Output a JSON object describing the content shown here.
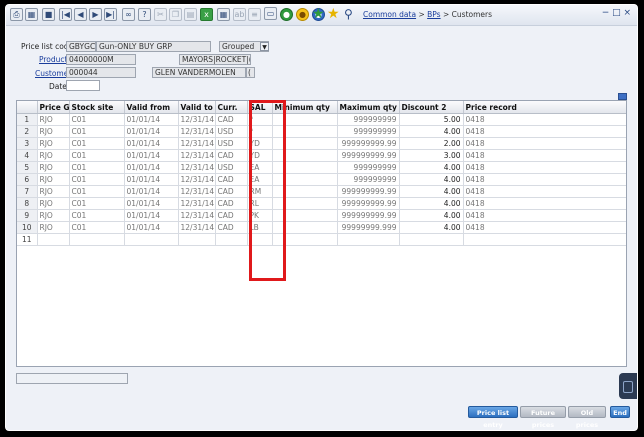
{
  "toolbar": {
    "icons": [
      "printer-icon",
      "table-icon",
      "stop-icon",
      "first-record-icon",
      "previous-record-icon",
      "next-record-icon",
      "last-record-icon",
      "link-icon",
      "help-icon",
      "cut-icon",
      "copy-icon",
      "paste-icon",
      "excel-export-icon",
      "calendar-icon",
      "ab-text-icon",
      "insert-icon",
      "document-icon",
      "green-circle-icon",
      "yellow-circle-icon",
      "blue-circle-icon",
      "green-star-icon",
      "yellow-star-icon",
      "wrench-icon"
    ],
    "breadcrumb": {
      "link1": "Common data",
      "sep1": ">",
      "link2": "BPs",
      "sep2": ">",
      "current": "Customers"
    },
    "window_buttons": "− □ ×"
  },
  "form": {
    "price_list_code_label": "Price list code",
    "price_list_code": "GBYGCD",
    "price_list_desc": "Gun-ONLY BUY GRP",
    "grouped_value": "Grouped",
    "product_label": "Product",
    "product_code": "04000000M",
    "product_desc": "MAYORS|ROCKET|(12)",
    "customer_label": "Customer",
    "customer_code": "000044",
    "customer_name": "GLEN VANDERMOLEN",
    "customer_extra": "(",
    "date_label": "Date",
    "date_value": ""
  },
  "grid": {
    "columns": [
      "",
      "Price Gr",
      "Stock site",
      "Valid from",
      "Valid to",
      "Curr.",
      "SAL",
      "Minimum qty",
      "Maximum qty",
      "Discount 2",
      "Price record"
    ],
    "rows": [
      {
        "n": "1",
        "pg": "RJO",
        "site": "C01",
        "from": "01/01/14",
        "to": "12/31/14",
        "curr": "CAD",
        "sal": "*",
        "min": "",
        "max": "999999999",
        "disc": "5.00",
        "rec": "0418"
      },
      {
        "n": "2",
        "pg": "RJO",
        "site": "C01",
        "from": "01/01/14",
        "to": "12/31/14",
        "curr": "USD",
        "sal": "*",
        "min": "",
        "max": "999999999",
        "disc": "4.00",
        "rec": "0418"
      },
      {
        "n": "3",
        "pg": "RJO",
        "site": "C01",
        "from": "01/01/14",
        "to": "12/31/14",
        "curr": "USD",
        "sal": "YD",
        "min": "",
        "max": "999999999.99",
        "disc": "2.00",
        "rec": "0418"
      },
      {
        "n": "4",
        "pg": "RJO",
        "site": "C01",
        "from": "01/01/14",
        "to": "12/31/14",
        "curr": "CAD",
        "sal": "YD",
        "min": "",
        "max": "999999999.99",
        "disc": "3.00",
        "rec": "0418"
      },
      {
        "n": "5",
        "pg": "RJO",
        "site": "C01",
        "from": "01/01/14",
        "to": "12/31/14",
        "curr": "USD",
        "sal": "EA",
        "min": "",
        "max": "999999999",
        "disc": "4.00",
        "rec": "0418"
      },
      {
        "n": "6",
        "pg": "RJO",
        "site": "C01",
        "from": "01/01/14",
        "to": "12/31/14",
        "curr": "CAD",
        "sal": "EA",
        "min": "",
        "max": "999999999",
        "disc": "4.00",
        "rec": "0418"
      },
      {
        "n": "7",
        "pg": "RJO",
        "site": "C01",
        "from": "01/01/14",
        "to": "12/31/14",
        "curr": "CAD",
        "sal": "RM",
        "min": "",
        "max": "999999999.99",
        "disc": "4.00",
        "rec": "0418"
      },
      {
        "n": "8",
        "pg": "RJO",
        "site": "C01",
        "from": "01/01/14",
        "to": "12/31/14",
        "curr": "CAD",
        "sal": "RL",
        "min": "",
        "max": "999999999.99",
        "disc": "4.00",
        "rec": "0418"
      },
      {
        "n": "9",
        "pg": "RJO",
        "site": "C01",
        "from": "01/01/14",
        "to": "12/31/14",
        "curr": "CAD",
        "sal": "PK",
        "min": "",
        "max": "999999999.99",
        "disc": "4.00",
        "rec": "0418"
      },
      {
        "n": "10",
        "pg": "RJO",
        "site": "C01",
        "from": "01/01/14",
        "to": "12/31/14",
        "curr": "CAD",
        "sal": "LB",
        "min": "",
        "max": "99999999.999",
        "disc": "4.00",
        "rec": "0418"
      },
      {
        "n": "11",
        "pg": "",
        "site": "",
        "from": "",
        "to": "",
        "curr": "",
        "sal": "",
        "min": "",
        "max": "",
        "disc": "",
        "rec": ""
      }
    ]
  },
  "footer": {
    "price_list_entry": "Price list entry",
    "future_prices": "Future prices",
    "old_prices": "Old prices",
    "end": "End"
  },
  "colors": {
    "highlight": "#e0191b",
    "accent": "#2c6fbf"
  }
}
